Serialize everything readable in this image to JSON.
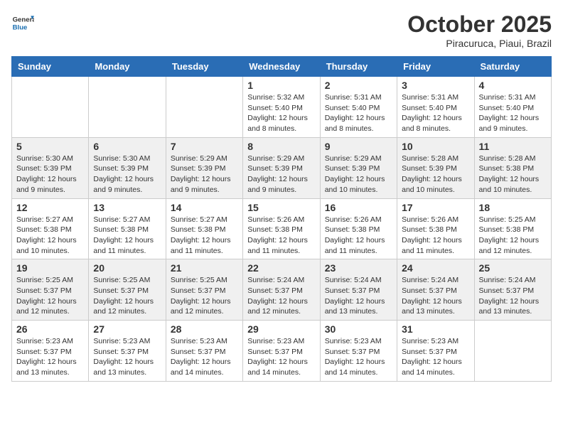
{
  "logo": {
    "general": "General",
    "blue": "Blue"
  },
  "title": "October 2025",
  "subtitle": "Piracuruca, Piaui, Brazil",
  "days_of_week": [
    "Sunday",
    "Monday",
    "Tuesday",
    "Wednesday",
    "Thursday",
    "Friday",
    "Saturday"
  ],
  "weeks": [
    [
      {
        "day": "",
        "info": ""
      },
      {
        "day": "",
        "info": ""
      },
      {
        "day": "",
        "info": ""
      },
      {
        "day": "1",
        "info": "Sunrise: 5:32 AM\nSunset: 5:40 PM\nDaylight: 12 hours\nand 8 minutes."
      },
      {
        "day": "2",
        "info": "Sunrise: 5:31 AM\nSunset: 5:40 PM\nDaylight: 12 hours\nand 8 minutes."
      },
      {
        "day": "3",
        "info": "Sunrise: 5:31 AM\nSunset: 5:40 PM\nDaylight: 12 hours\nand 8 minutes."
      },
      {
        "day": "4",
        "info": "Sunrise: 5:31 AM\nSunset: 5:40 PM\nDaylight: 12 hours\nand 9 minutes."
      }
    ],
    [
      {
        "day": "5",
        "info": "Sunrise: 5:30 AM\nSunset: 5:39 PM\nDaylight: 12 hours\nand 9 minutes."
      },
      {
        "day": "6",
        "info": "Sunrise: 5:30 AM\nSunset: 5:39 PM\nDaylight: 12 hours\nand 9 minutes."
      },
      {
        "day": "7",
        "info": "Sunrise: 5:29 AM\nSunset: 5:39 PM\nDaylight: 12 hours\nand 9 minutes."
      },
      {
        "day": "8",
        "info": "Sunrise: 5:29 AM\nSunset: 5:39 PM\nDaylight: 12 hours\nand 9 minutes."
      },
      {
        "day": "9",
        "info": "Sunrise: 5:29 AM\nSunset: 5:39 PM\nDaylight: 12 hours\nand 10 minutes."
      },
      {
        "day": "10",
        "info": "Sunrise: 5:28 AM\nSunset: 5:39 PM\nDaylight: 12 hours\nand 10 minutes."
      },
      {
        "day": "11",
        "info": "Sunrise: 5:28 AM\nSunset: 5:38 PM\nDaylight: 12 hours\nand 10 minutes."
      }
    ],
    [
      {
        "day": "12",
        "info": "Sunrise: 5:27 AM\nSunset: 5:38 PM\nDaylight: 12 hours\nand 10 minutes."
      },
      {
        "day": "13",
        "info": "Sunrise: 5:27 AM\nSunset: 5:38 PM\nDaylight: 12 hours\nand 11 minutes."
      },
      {
        "day": "14",
        "info": "Sunrise: 5:27 AM\nSunset: 5:38 PM\nDaylight: 12 hours\nand 11 minutes."
      },
      {
        "day": "15",
        "info": "Sunrise: 5:26 AM\nSunset: 5:38 PM\nDaylight: 12 hours\nand 11 minutes."
      },
      {
        "day": "16",
        "info": "Sunrise: 5:26 AM\nSunset: 5:38 PM\nDaylight: 12 hours\nand 11 minutes."
      },
      {
        "day": "17",
        "info": "Sunrise: 5:26 AM\nSunset: 5:38 PM\nDaylight: 12 hours\nand 11 minutes."
      },
      {
        "day": "18",
        "info": "Sunrise: 5:25 AM\nSunset: 5:38 PM\nDaylight: 12 hours\nand 12 minutes."
      }
    ],
    [
      {
        "day": "19",
        "info": "Sunrise: 5:25 AM\nSunset: 5:37 PM\nDaylight: 12 hours\nand 12 minutes."
      },
      {
        "day": "20",
        "info": "Sunrise: 5:25 AM\nSunset: 5:37 PM\nDaylight: 12 hours\nand 12 minutes."
      },
      {
        "day": "21",
        "info": "Sunrise: 5:25 AM\nSunset: 5:37 PM\nDaylight: 12 hours\nand 12 minutes."
      },
      {
        "day": "22",
        "info": "Sunrise: 5:24 AM\nSunset: 5:37 PM\nDaylight: 12 hours\nand 12 minutes."
      },
      {
        "day": "23",
        "info": "Sunrise: 5:24 AM\nSunset: 5:37 PM\nDaylight: 12 hours\nand 13 minutes."
      },
      {
        "day": "24",
        "info": "Sunrise: 5:24 AM\nSunset: 5:37 PM\nDaylight: 12 hours\nand 13 minutes."
      },
      {
        "day": "25",
        "info": "Sunrise: 5:24 AM\nSunset: 5:37 PM\nDaylight: 12 hours\nand 13 minutes."
      }
    ],
    [
      {
        "day": "26",
        "info": "Sunrise: 5:23 AM\nSunset: 5:37 PM\nDaylight: 12 hours\nand 13 minutes."
      },
      {
        "day": "27",
        "info": "Sunrise: 5:23 AM\nSunset: 5:37 PM\nDaylight: 12 hours\nand 13 minutes."
      },
      {
        "day": "28",
        "info": "Sunrise: 5:23 AM\nSunset: 5:37 PM\nDaylight: 12 hours\nand 14 minutes."
      },
      {
        "day": "29",
        "info": "Sunrise: 5:23 AM\nSunset: 5:37 PM\nDaylight: 12 hours\nand 14 minutes."
      },
      {
        "day": "30",
        "info": "Sunrise: 5:23 AM\nSunset: 5:37 PM\nDaylight: 12 hours\nand 14 minutes."
      },
      {
        "day": "31",
        "info": "Sunrise: 5:23 AM\nSunset: 5:37 PM\nDaylight: 12 hours\nand 14 minutes."
      },
      {
        "day": "",
        "info": ""
      }
    ]
  ]
}
